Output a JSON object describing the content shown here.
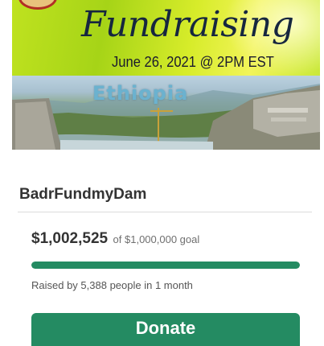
{
  "banner": {
    "title": "Fundraising",
    "date": "June 26, 2021 @ 2PM EST",
    "country": "Ethiopia"
  },
  "campaign": {
    "title": "BadrFundmyDam"
  },
  "progress": {
    "raised": "$1,002,525",
    "goal_text": "of $1,000,000 goal",
    "fraction": 1.0,
    "raised_by": "Raised by 5,388 people in 1 month",
    "color": "#248b62"
  },
  "actions": {
    "donate_label": "Donate"
  }
}
